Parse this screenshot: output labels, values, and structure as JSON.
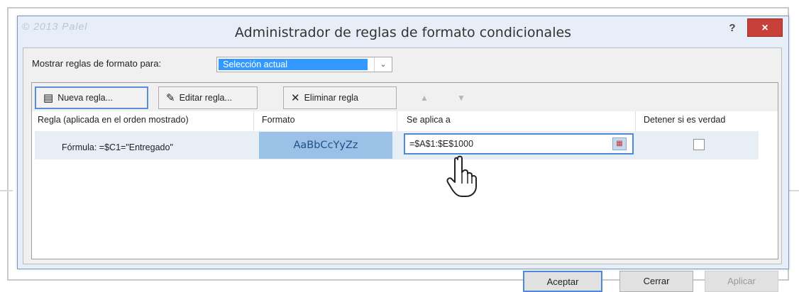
{
  "watermark": "© 2013 Palel",
  "dialog": {
    "title": "Administrador de reglas de formato condicionales",
    "help_label": "?",
    "close_label": "×"
  },
  "show_rules": {
    "label": "Mostrar reglas de formato para:",
    "value": "Selección actual"
  },
  "toolbar": {
    "new_label": "Nueva regla...",
    "edit_label": "Editar regla...",
    "delete_label": "Eliminar regla"
  },
  "columns": {
    "rule": "Regla (aplicada en el orden mostrado)",
    "format": "Formato",
    "applies_to": "Se aplica a",
    "stop_if_true": "Detener si es verdad"
  },
  "rules": [
    {
      "rule": "Fórmula: =$C1=\"Entregado\"",
      "format_preview": "AaBbCcYyZz",
      "applies_to": "=$A$1:$E$1000",
      "stop_if_true": false
    }
  ],
  "footer": {
    "ok_label": "Aceptar",
    "close_label": "Cerrar",
    "apply_label": "Aplicar"
  },
  "colors": {
    "accent": "#3399ff",
    "format_preview_bg": "#9bc2e6",
    "close_button": "#c7413a"
  }
}
